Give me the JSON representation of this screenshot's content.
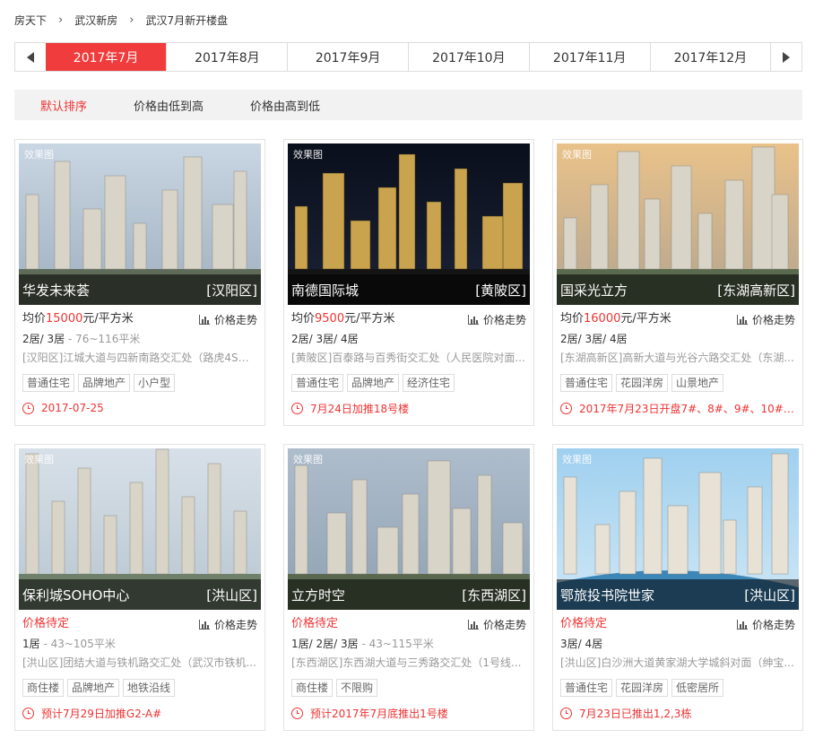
{
  "breadcrumb": [
    "房天下",
    "武汉新房",
    "武汉7月新开楼盘"
  ],
  "months": [
    "2017年7月",
    "2017年8月",
    "2017年9月",
    "2017年10月",
    "2017年11月",
    "2017年12月"
  ],
  "active_month": "2017年7月",
  "sort_options": [
    "默认排序",
    "价格由低到高",
    "价格由高到低"
  ],
  "effect_label": "效果图",
  "trend_label": "价格走势",
  "cards": [
    {
      "name": "华发未来荟",
      "district": "[汉阳区]",
      "price_prefix": "均价",
      "price_num": "15000",
      "price_unit": "元/平方米",
      "rooms": "2居/ 3居",
      "area": " - 76~116平米",
      "addr": "[汉阳区]江城大道与四新南路交汇处（路虎4S店...",
      "tags": [
        "普通住宅",
        "品牌地产",
        "小户型"
      ],
      "promo": "2017-07-25"
    },
    {
      "name": "南德国际城",
      "district": "[黄陂区]",
      "price_prefix": "均价",
      "price_num": "9500",
      "price_unit": "元/平方米",
      "rooms": "2居/ 3居/ 4居",
      "area": "",
      "addr": "[黄陂区]百泰路与百秀街交汇处（人民医院对面...",
      "tags": [
        "普通住宅",
        "品牌地产",
        "经济住宅"
      ],
      "promo": "7月24日加推18号楼"
    },
    {
      "name": "国采光立方",
      "district": "[东湖高新区]",
      "price_prefix": "均价",
      "price_num": "16000",
      "price_unit": "元/平方米",
      "rooms": "2居/ 3居/ 4居",
      "area": "",
      "addr": "[东湖高新区]高新大道与光谷六路交汇处（东湖...",
      "tags": [
        "普通住宅",
        "花园洋房",
        "山景地产"
      ],
      "promo": "2017年7月23日开盘7#、8#、9#、10#、1..."
    },
    {
      "name": "保利城SOHO中心",
      "district": "[洪山区]",
      "price_pending": "价格待定",
      "rooms": "1居",
      "area": " - 43~105平米",
      "addr": "[洪山区]团结大道与铁机路交汇处（武汉市铁机...",
      "tags": [
        "商住楼",
        "品牌地产",
        "地铁沿线"
      ],
      "promo": "预计7月29日加推G2-A#"
    },
    {
      "name": "立方时空",
      "district": "[东西湖区]",
      "price_pending": "价格待定",
      "rooms": "1居/ 2居/ 3居",
      "area": " - 43~115平米",
      "addr": "[东西湖区]东西湖大道与三秀路交汇处（1号线...",
      "tags": [
        "商住楼",
        "不限购"
      ],
      "promo": "预计2017年7月底推出1号楼"
    },
    {
      "name": "鄂旅投书院世家",
      "district": "[洪山区]",
      "price_pending": "价格待定",
      "rooms": "3居/ 4居",
      "area": "",
      "addr": "[洪山区]白沙洲大道黄家湖大学城斜对面（绅宝...",
      "tags": [
        "普通住宅",
        "花园洋房",
        "低密居所"
      ],
      "promo": "7月23日已推出1,2,3栋"
    }
  ],
  "colors": {
    "accent": "#f03c3c",
    "price": "#e33333"
  }
}
